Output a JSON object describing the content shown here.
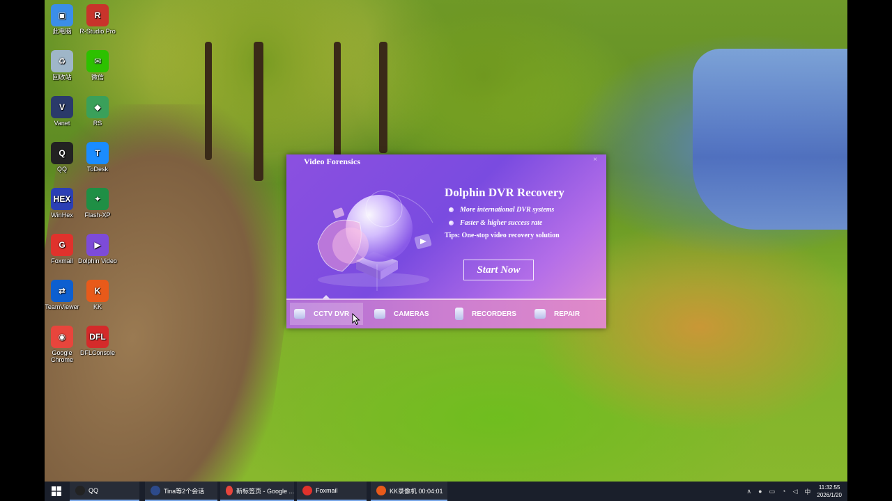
{
  "desktop_icons": [
    {
      "label": "此电脑",
      "icon": "computer-icon",
      "color": "#3b8ee8",
      "glyph": "▣"
    },
    {
      "label": "R-Studio Pro",
      "icon": "rstudio-icon",
      "color": "#c8342b",
      "glyph": "R"
    },
    {
      "label": "回收站",
      "icon": "recycle-bin-icon",
      "color": "#9fb6c8",
      "glyph": "♻"
    },
    {
      "label": "微信",
      "icon": "wechat-icon",
      "color": "#2dc100",
      "glyph": "✉"
    },
    {
      "label": "Vanet",
      "icon": "vanet-icon",
      "color": "#2a3a6a",
      "glyph": "V"
    },
    {
      "label": "RS",
      "icon": "rs-icon",
      "color": "#3aa05a",
      "glyph": "◆"
    },
    {
      "label": "QQ",
      "icon": "qq-icon",
      "color": "#222222",
      "glyph": "Q"
    },
    {
      "label": "ToDesk",
      "icon": "todesk-icon",
      "color": "#1a8cff",
      "glyph": "T"
    },
    {
      "label": "WinHex",
      "icon": "winhex-icon",
      "color": "#2b3fb5",
      "glyph": "HEX"
    },
    {
      "label": "Flash-XP",
      "icon": "flash-xp-icon",
      "color": "#1f8f45",
      "glyph": "✦"
    },
    {
      "label": "Foxmail",
      "icon": "foxmail-icon",
      "color": "#e0322c",
      "glyph": "G"
    },
    {
      "label": "Dolphin Video",
      "icon": "dolphin-video-icon",
      "color": "#7d4bd8",
      "glyph": "▶"
    },
    {
      "label": "TeamViewer",
      "icon": "teamviewer-icon",
      "color": "#0d5fd0",
      "glyph": "⇄"
    },
    {
      "label": "KK",
      "icon": "kk-icon",
      "color": "#e85a1a",
      "glyph": "K"
    },
    {
      "label": "Google Chrome",
      "icon": "chrome-icon",
      "color": "#e8453c",
      "glyph": "◉"
    },
    {
      "label": "DFLConsole",
      "icon": "dflconsole-icon",
      "color": "#d42a2a",
      "glyph": "DFL"
    }
  ],
  "app": {
    "window_title": "Video Forensics",
    "close_label": "×",
    "headline": "Dolphin DVR Recovery",
    "features": [
      "More international DVR systems",
      "Faster & higher success rate"
    ],
    "tips": "Tips: One-stop video recovery solution",
    "start_button": "Start Now",
    "nav": [
      {
        "label": "CCTV DVR",
        "icon": "cctv-dvr-icon",
        "active": true
      },
      {
        "label": "CAMERAS",
        "icon": "camera-icon",
        "active": false
      },
      {
        "label": "RECORDERS",
        "icon": "recorder-icon",
        "active": false
      },
      {
        "label": "REPAIR",
        "icon": "repair-icon",
        "active": false
      }
    ]
  },
  "taskbar": {
    "items": [
      {
        "label": "QQ",
        "icon": "qq-icon",
        "color": "#222222"
      },
      {
        "label": "Tina等2个会话",
        "icon": "chat-icon",
        "color": "#2d4a8a"
      },
      {
        "label": "新标签页 - Google ...",
        "icon": "chrome-icon",
        "color": "#e8453c"
      },
      {
        "label": "Foxmail",
        "icon": "foxmail-icon",
        "color": "#e0322c"
      },
      {
        "label": "KK录像机 00:04:01",
        "icon": "kk-icon",
        "color": "#e85a1a"
      }
    ],
    "tray": {
      "overflow": "∧",
      "ime": "中",
      "time": "11:32:55",
      "date": "2026/1/20"
    }
  }
}
